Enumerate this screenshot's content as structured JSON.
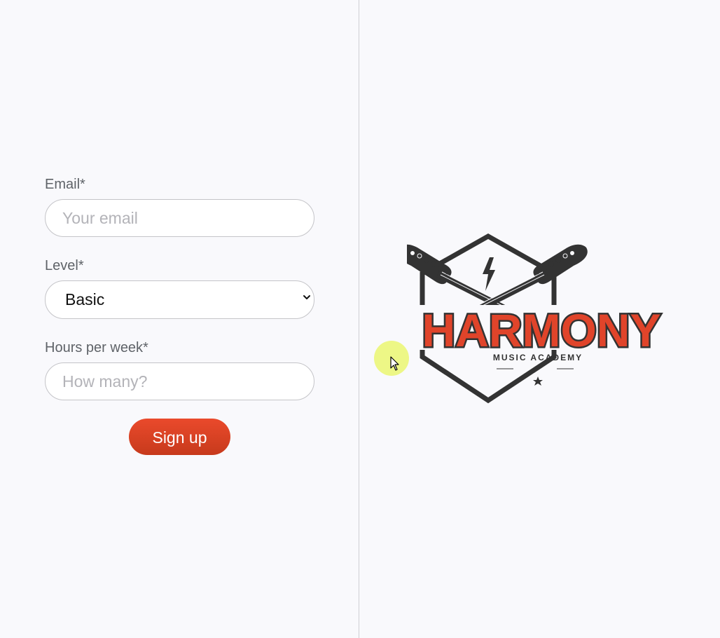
{
  "form": {
    "email": {
      "label": "Email*",
      "placeholder": "Your email",
      "value": ""
    },
    "level": {
      "label": "Level*",
      "selected": "Basic"
    },
    "hours": {
      "label": "Hours per week*",
      "placeholder": "How many?",
      "value": ""
    },
    "submit_label": "Sign up"
  },
  "logo": {
    "title": "HARMONY",
    "subtitle": "MUSIC ACADEMY",
    "icons": [
      "guitar-icon",
      "lightning-icon",
      "star-icon"
    ]
  },
  "colors": {
    "accent": "#e0442a",
    "logo_dark": "#333333",
    "background": "#f9f9fc"
  }
}
